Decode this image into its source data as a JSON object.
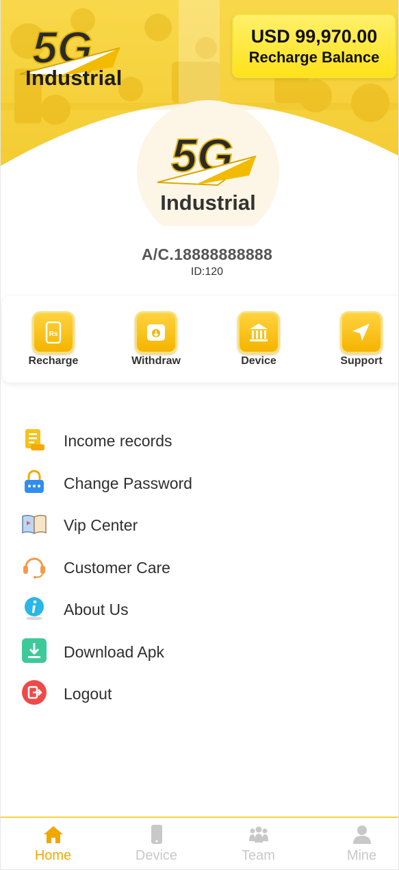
{
  "header": {
    "brand_mark": "5G",
    "brand_name": "Industrial",
    "balance_amount": "USD 99,970.00",
    "balance_label": "Recharge Balance"
  },
  "profile": {
    "avatar_mark": "5G",
    "avatar_name": "Industrial",
    "account": "A/C.18888888888",
    "user_id": "ID:120"
  },
  "quick_actions": [
    {
      "label": "Recharge",
      "icon": "rupee-phone-icon"
    },
    {
      "label": "Withdraw",
      "icon": "wallet-icon"
    },
    {
      "label": "Device",
      "icon": "bank-building-icon"
    },
    {
      "label": "Support",
      "icon": "paper-plane-icon"
    }
  ],
  "menu": [
    {
      "label": "Income records",
      "icon": "receipt-scroll-icon"
    },
    {
      "label": "Change Password",
      "icon": "padlock-password-icon"
    },
    {
      "label": "Vip Center",
      "icon": "open-book-icon"
    },
    {
      "label": "Customer Care",
      "icon": "headset-icon"
    },
    {
      "label": "About Us",
      "icon": "info-icon"
    },
    {
      "label": "Download Apk",
      "icon": "download-icon"
    },
    {
      "label": "Logout",
      "icon": "logout-icon"
    }
  ],
  "bottom_nav": [
    {
      "label": "Home",
      "icon": "home-icon",
      "active": true
    },
    {
      "label": "Device",
      "icon": "phone-icon",
      "active": false
    },
    {
      "label": "Team",
      "icon": "team-icon",
      "active": false
    },
    {
      "label": "Mine",
      "icon": "person-icon",
      "active": false
    }
  ],
  "colors": {
    "accent": "#f5b400",
    "balance_card": "#ffe21a",
    "nav_active": "#f0a800",
    "nav_inactive": "#c8c8c8"
  }
}
